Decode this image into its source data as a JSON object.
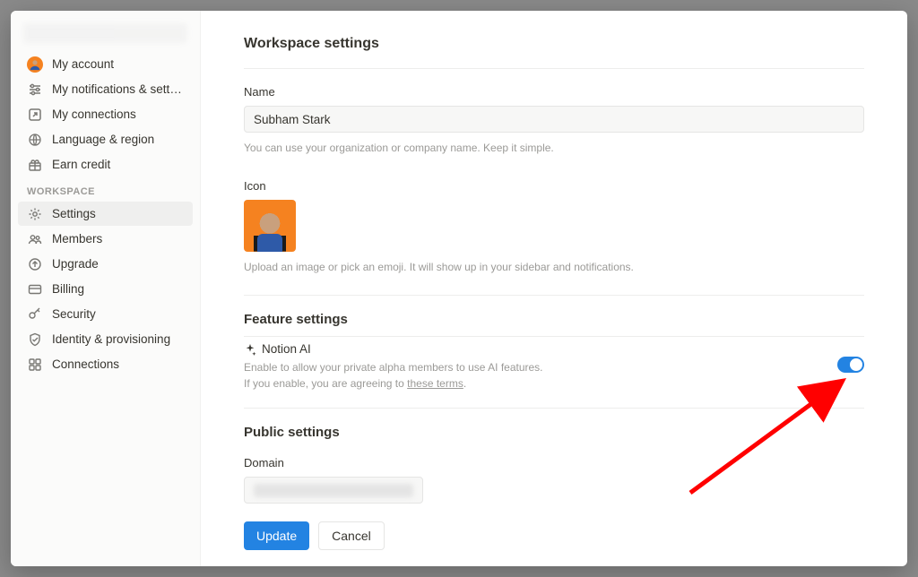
{
  "sidebar": {
    "account": [
      {
        "id": "my-account",
        "label": "My account",
        "icon": "avatar"
      },
      {
        "id": "my-notifications",
        "label": "My notifications & settings",
        "icon": "sliders"
      },
      {
        "id": "my-connections",
        "label": "My connections",
        "icon": "link-out"
      },
      {
        "id": "language-region",
        "label": "Language & region",
        "icon": "globe"
      },
      {
        "id": "earn-credit",
        "label": "Earn credit",
        "icon": "gift"
      }
    ],
    "workspace_label": "WORKSPACE",
    "workspace": [
      {
        "id": "settings",
        "label": "Settings",
        "icon": "gear",
        "active": true
      },
      {
        "id": "members",
        "label": "Members",
        "icon": "people"
      },
      {
        "id": "upgrade",
        "label": "Upgrade",
        "icon": "circle-up"
      },
      {
        "id": "billing",
        "label": "Billing",
        "icon": "card"
      },
      {
        "id": "security",
        "label": "Security",
        "icon": "key"
      },
      {
        "id": "identity-provisioning",
        "label": "Identity & provisioning",
        "icon": "shield-check"
      },
      {
        "id": "connections",
        "label": "Connections",
        "icon": "grid4"
      }
    ]
  },
  "page": {
    "title": "Workspace settings",
    "name": {
      "label": "Name",
      "value": "Subham Stark",
      "help": "You can use your organization or company name. Keep it simple."
    },
    "icon": {
      "label": "Icon",
      "help": "Upload an image or pick an emoji. It will show up in your sidebar and notifications."
    },
    "feature_settings": {
      "heading": "Feature settings",
      "notion_ai": {
        "name": "Notion AI",
        "desc_line1": "Enable to allow your private alpha members to use AI features.",
        "desc_line2_prefix": "If you enable, you are agreeing to ",
        "desc_line2_link": "these terms",
        "desc_line2_suffix": ".",
        "enabled": true
      }
    },
    "public_settings": {
      "heading": "Public settings",
      "domain_label": "Domain"
    },
    "buttons": {
      "update": "Update",
      "cancel": "Cancel"
    }
  }
}
